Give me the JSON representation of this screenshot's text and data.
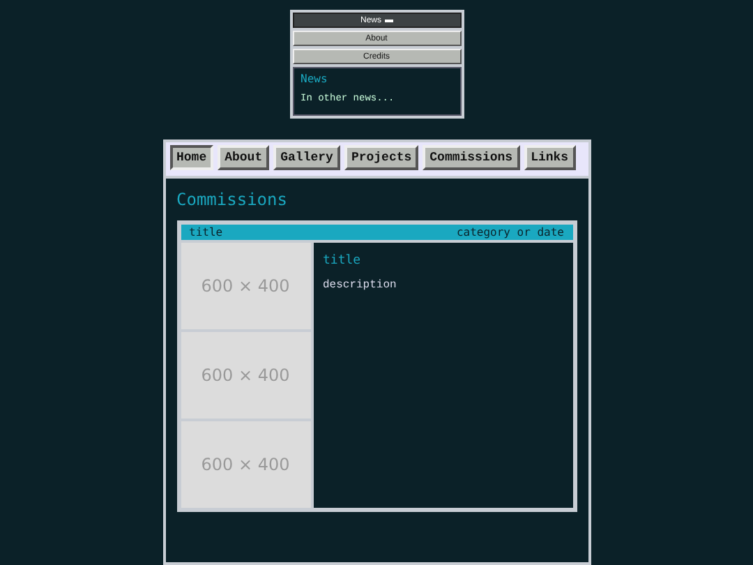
{
  "side_menu": {
    "buttons": [
      {
        "label": "News",
        "selected": true
      },
      {
        "label": "About",
        "selected": false
      },
      {
        "label": "Credits",
        "selected": false
      }
    ],
    "panel": {
      "heading": "News",
      "text": "In other news..."
    }
  },
  "nav": {
    "tabs": [
      {
        "label": "Home",
        "selected": true
      },
      {
        "label": "About",
        "selected": false
      },
      {
        "label": "Gallery",
        "selected": false
      },
      {
        "label": "Projects",
        "selected": false
      },
      {
        "label": "Commissions",
        "selected": false
      },
      {
        "label": "Links",
        "selected": false
      }
    ]
  },
  "page": {
    "heading": "Commissions",
    "card": {
      "header_title": "title",
      "header_meta": "category or date",
      "images": [
        "600 × 400",
        "600 × 400",
        "600 × 400"
      ],
      "title": "title",
      "description": "description"
    }
  }
}
